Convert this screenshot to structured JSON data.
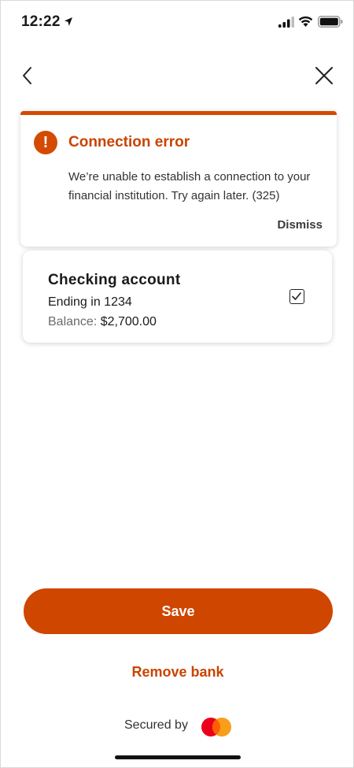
{
  "status_bar": {
    "time": "12:22",
    "icons": [
      "location-arrow-icon",
      "cellular-signal-icon",
      "wifi-icon",
      "battery-icon"
    ]
  },
  "nav": {
    "back_icon": "chevron-left-icon",
    "close_icon": "close-icon"
  },
  "error": {
    "icon": "exclamation-icon",
    "title": "Connection error",
    "message": "We’re unable to establish a connection to your financial institution. Try again later. (325)",
    "dismiss_label": "Dismiss"
  },
  "account": {
    "name": "Checking account",
    "ending": "Ending in 1234",
    "balance_label": "Balance:",
    "balance_value": "$2,700.00",
    "checked": true
  },
  "actions": {
    "save_label": "Save",
    "remove_bank_label": "Remove bank"
  },
  "footer": {
    "secured_by": "Secured by",
    "logo": "mastercard-logo"
  },
  "colors": {
    "accent": "#cf4600",
    "accent_text": "#c94400",
    "mastercard_red": "#eb001b",
    "mastercard_yellow": "#f79e1b"
  }
}
